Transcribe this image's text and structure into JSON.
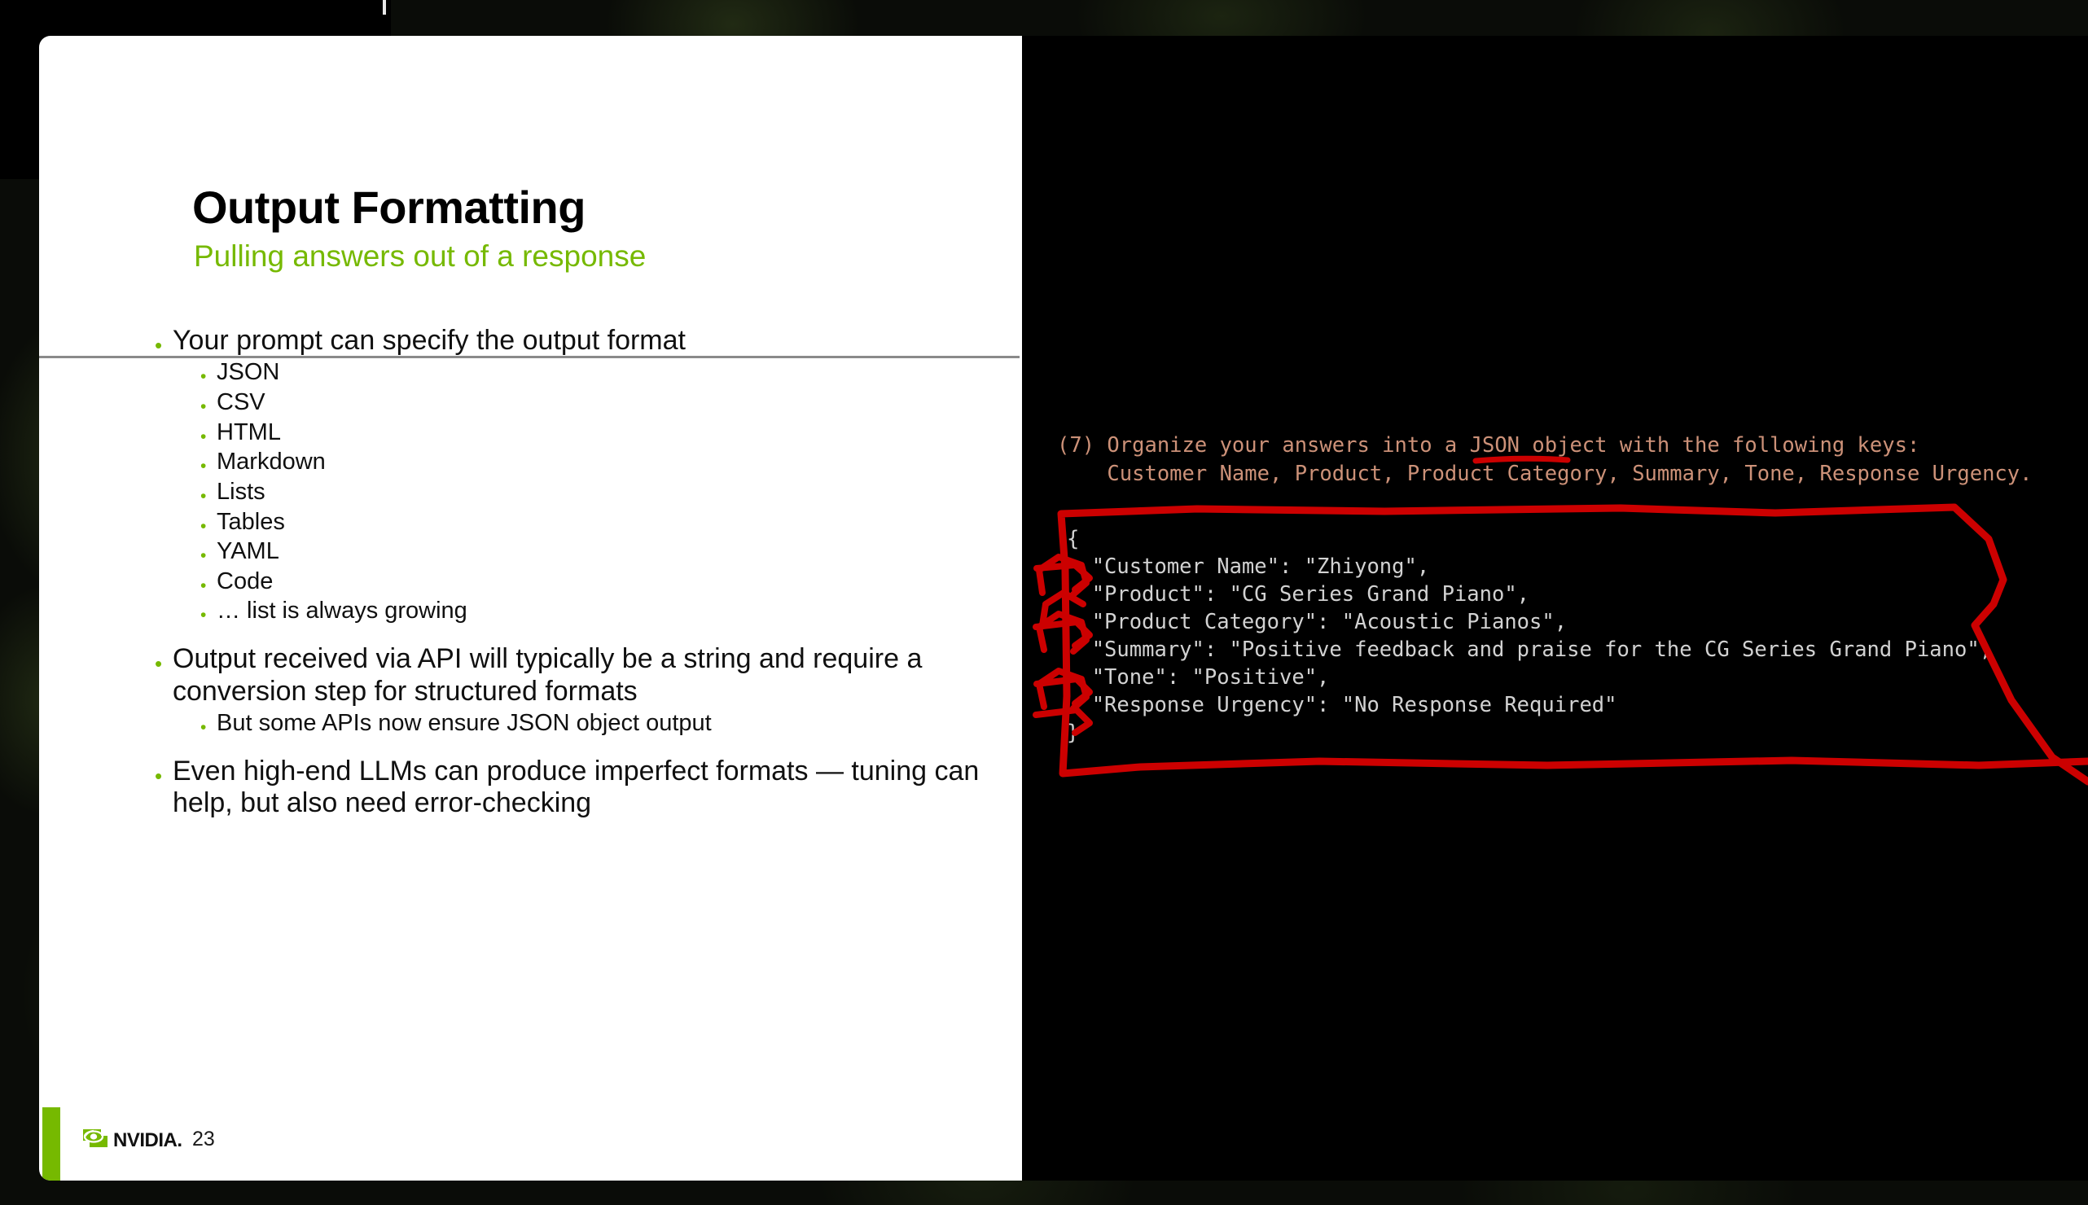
{
  "window": {
    "background_color": "#0a0c08",
    "terminal_background": "#000000",
    "slide_background": "#ffffff"
  },
  "slide": {
    "title": "Output Formatting",
    "subtitle": "Pulling answers out of a response",
    "accent_color": "#76b900",
    "bullets": [
      {
        "level": 1,
        "text": "Your prompt can specify the output format",
        "children": [
          "JSON",
          "CSV",
          "HTML",
          "Markdown",
          "Lists",
          "Tables",
          "YAML",
          "Code",
          "… list is always growing"
        ]
      },
      {
        "level": 1,
        "text": "Output received via API will typically be a string and require a conversion step for structured formats",
        "children": [
          "But some APIs now ensure JSON object output"
        ]
      },
      {
        "level": 1,
        "text": "Even high-end LLMs can produce imperfect formats — tuning can help, but also need error-checking",
        "children": []
      }
    ],
    "footer": {
      "logo_text": "NVIDIA.",
      "logo_icon": "nvidia-eye-icon",
      "page_number": "23"
    }
  },
  "terminal": {
    "prompt_color": "#cc9178",
    "output_color": "#d2d2d2",
    "prompt_lines": [
      "(7) Organize your answers into a JSON object with the following keys:",
      "    Customer Name, Product, Product Category, Summary, Tone, Response Urgency."
    ],
    "prompt_underlined_phrase": "JSON object",
    "json_output_lines": [
      "{",
      "  \"Customer Name\": \"Zhiyong\",",
      "  \"Product\": \"CG Series Grand Piano\",",
      "  \"Product Category\": \"Acoustic Pianos\",",
      "  \"Summary\": \"Positive feedback and praise for the CG Series Grand Piano\",",
      "  \"Tone\": \"Positive\",",
      "  \"Response Urgency\": \"No Response Required\"",
      "}"
    ]
  },
  "annotations": {
    "color": "#cc0000",
    "shapes": [
      {
        "name": "underline-json-object",
        "type": "underline"
      },
      {
        "name": "highlight-box-json-output",
        "type": "hand-drawn-rectangle"
      },
      {
        "name": "checkmarks-json-keys",
        "type": "tick-marks",
        "count": 6
      }
    ]
  }
}
